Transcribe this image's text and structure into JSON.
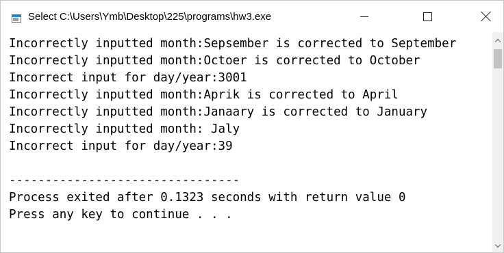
{
  "window": {
    "title": "Select C:\\Users\\Ymb\\Desktop\\225\\programs\\hw3.exe",
    "minimize_icon": "minimize-icon",
    "maximize_icon": "maximize-icon",
    "close_icon": "close-icon",
    "app_icon": "console-app-icon"
  },
  "console": {
    "lines": [
      "Incorrectly inputted month:Sepsember is corrected to September",
      "Incorrectly inputted month:Octoer is corrected to October",
      "Incorrect input for day/year:3001",
      "Incorrectly inputted month:Aprik is corrected to April",
      "Incorrectly inputted month:Janaary is corrected to January",
      "Incorrectly inputted month: Jaly",
      "Incorrect input for day/year:39",
      "",
      "--------------------------------",
      "Process exited after 0.1323 seconds with return value 0",
      "Press any key to continue . . ."
    ]
  },
  "scrollbar": {
    "up_icon": "chevron-up-icon",
    "down_icon": "chevron-down-icon"
  }
}
